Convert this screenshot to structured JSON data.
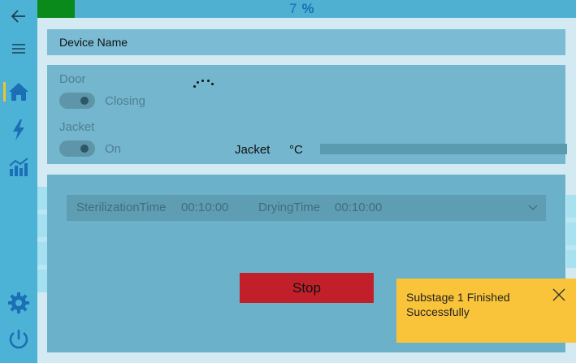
{
  "progress": {
    "value": "7",
    "unit": "%",
    "fraction": 0.07
  },
  "sidebar": {
    "items": [
      {
        "icon": "back-arrow-icon"
      },
      {
        "icon": "hamburger-menu-icon"
      },
      {
        "icon": "home-icon",
        "active": true
      },
      {
        "icon": "lightning-icon"
      },
      {
        "icon": "chart-icon"
      },
      {
        "icon": "gear-icon"
      },
      {
        "icon": "power-icon"
      }
    ]
  },
  "header": {
    "device_name": "Device Name"
  },
  "status": {
    "door_label": "Door",
    "door_state": "Closing",
    "jacket_label": "Jacket",
    "jacket_state": "On",
    "jacket_temp_label": "Jacket",
    "temp_unit": "°C"
  },
  "program": {
    "sterilization_label": "SterilizationTime",
    "sterilization_value": "00:10:00",
    "drying_label": "DryingTime",
    "drying_value": "00:10:00"
  },
  "actions": {
    "stop_label": "Stop"
  },
  "toast": {
    "message": "Substage 1 Finished Successfully"
  },
  "colors": {
    "accent_yellow": "#f9c43a",
    "stop_red": "#c1202a",
    "progress_green": "#0a8a1a",
    "icon_blue": "#1a6fb5"
  }
}
